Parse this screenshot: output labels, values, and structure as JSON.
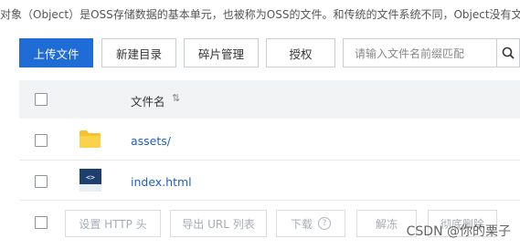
{
  "description": "对象（Object）是OSS存储数据的基本单元，也被称为OSS的文件。和传统的文件系统不同，Object没有文",
  "toolbar": {
    "upload_label": "上传文件",
    "new_dir_label": "新建目录",
    "fragments_label": "碎片管理",
    "authorize_label": "授权"
  },
  "search": {
    "placeholder": "请输入文件名前缀匹配"
  },
  "table": {
    "header_name": "文件名",
    "rows": [
      {
        "name": "assets/",
        "icon": "folder-icon"
      },
      {
        "name": "index.html",
        "icon": "html-file-icon"
      }
    ]
  },
  "footer": {
    "set_http_header": "设置 HTTP 头",
    "export_urls": "导出 URL 列表",
    "download": "下载",
    "unfreeze": "解冻",
    "delete_permanently": "彻底删除"
  },
  "watermark": "CSDN @你的栗子",
  "colors": {
    "primary": "#1f6cd6",
    "link": "#1f5fbf",
    "folder": "#f6c12c"
  }
}
